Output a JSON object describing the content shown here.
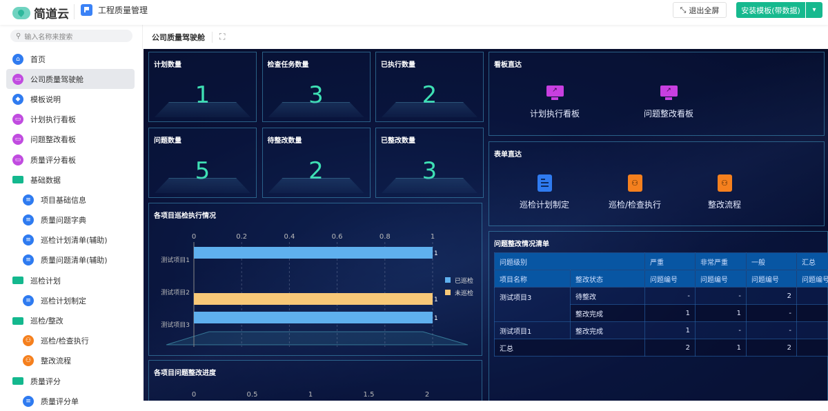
{
  "header": {
    "brand": "简道云",
    "app_name": "工程质量管理",
    "exit_fullscreen": "退出全屏",
    "install_template": "安装模板(带数据)"
  },
  "sidebar": {
    "search_placeholder": "输入名称来搜索",
    "items": [
      {
        "label": "首页",
        "icon": "home-icon",
        "color": "blue"
      },
      {
        "label": "公司质量驾驶舱",
        "icon": "dashboard-icon",
        "color": "purple",
        "active": true
      },
      {
        "label": "模板说明",
        "icon": "tag-icon",
        "color": "blue"
      },
      {
        "label": "计划执行看板",
        "icon": "dashboard-icon",
        "color": "purple"
      },
      {
        "label": "问题整改看板",
        "icon": "dashboard-icon",
        "color": "purple"
      },
      {
        "label": "质量评分看板",
        "icon": "dashboard-icon",
        "color": "purple"
      },
      {
        "label": "基础数据",
        "icon": "folder-icon",
        "color": "folder"
      },
      {
        "label": "项目基础信息",
        "icon": "form-icon",
        "color": "blue",
        "sub": true
      },
      {
        "label": "质量问题字典",
        "icon": "form-icon",
        "color": "blue",
        "sub": true
      },
      {
        "label": "巡检计划清单(辅助)",
        "icon": "form-icon",
        "color": "blue",
        "sub": true
      },
      {
        "label": "质量问题清单(辅助)",
        "icon": "flow-form-icon",
        "color": "blue",
        "sub": true
      },
      {
        "label": "巡检计划",
        "icon": "folder-icon",
        "color": "folder"
      },
      {
        "label": "巡检计划制定",
        "icon": "form-icon",
        "color": "blue",
        "sub": true
      },
      {
        "label": "巡检/整改",
        "icon": "folder-icon",
        "color": "folder"
      },
      {
        "label": "巡检/检查执行",
        "icon": "workflow-icon",
        "color": "orange",
        "sub": true
      },
      {
        "label": "整改流程",
        "icon": "workflow-icon",
        "color": "orange",
        "sub": true
      },
      {
        "label": "质量评分",
        "icon": "folder-icon",
        "color": "folder"
      },
      {
        "label": "质量评分单",
        "icon": "form-icon",
        "color": "blue",
        "sub": true
      }
    ]
  },
  "content": {
    "title": "公司质量驾驶舱"
  },
  "stats": [
    {
      "label": "计划数量",
      "value": "1"
    },
    {
      "label": "检查任务数量",
      "value": "3"
    },
    {
      "label": "已执行数量",
      "value": "2"
    },
    {
      "label": "问题数量",
      "value": "5"
    },
    {
      "label": "待整改数量",
      "value": "2"
    },
    {
      "label": "已整改数量",
      "value": "3"
    }
  ],
  "board_links": {
    "title": "看板直达",
    "items": [
      "计划执行看板",
      "问题整改看板"
    ]
  },
  "form_links": {
    "title": "表单直达",
    "items": [
      "巡检计划制定",
      "巡检/检查执行",
      "整改流程"
    ]
  },
  "issue_table": {
    "title": "问题整改情况清单",
    "header1": [
      "问题级别",
      "严重",
      "非常严重",
      "一般",
      "汇总"
    ],
    "header2": [
      "项目名称",
      "整改状态",
      "问题编号",
      "问题编号",
      "问题编号",
      "问题编号"
    ],
    "rows": [
      [
        "测试项目3",
        "待整改",
        "-",
        "-",
        "2",
        ""
      ],
      [
        "",
        "整改完成",
        "1",
        "1",
        "-",
        ""
      ],
      [
        "测试项目1",
        "整改完成",
        "1",
        "-",
        "-",
        ""
      ],
      [
        "汇总",
        "",
        "2",
        "1",
        "2",
        ""
      ]
    ]
  },
  "chart_data": [
    {
      "type": "bar",
      "orientation": "horizontal",
      "title": "各项目巡检执行情况",
      "categories": [
        "测试项目1",
        "测试项目2",
        "测试项目3"
      ],
      "series": [
        {
          "name": "已巡检",
          "color": "#5fb0ee",
          "values": [
            1,
            null,
            1
          ]
        },
        {
          "name": "未巡检",
          "color": "#f8c878",
          "values": [
            null,
            1,
            null
          ]
        }
      ],
      "xlim": [
        0,
        1
      ],
      "ticks": [
        "0",
        "0.2",
        "0.4",
        "0.6",
        "0.8",
        "1"
      ],
      "legend": "right"
    },
    {
      "type": "bar",
      "orientation": "horizontal",
      "title": "各项目问题整改进度",
      "xlim": [
        0,
        2
      ],
      "ticks": [
        "0",
        "0.5",
        "1",
        "1.5",
        "2"
      ]
    }
  ]
}
